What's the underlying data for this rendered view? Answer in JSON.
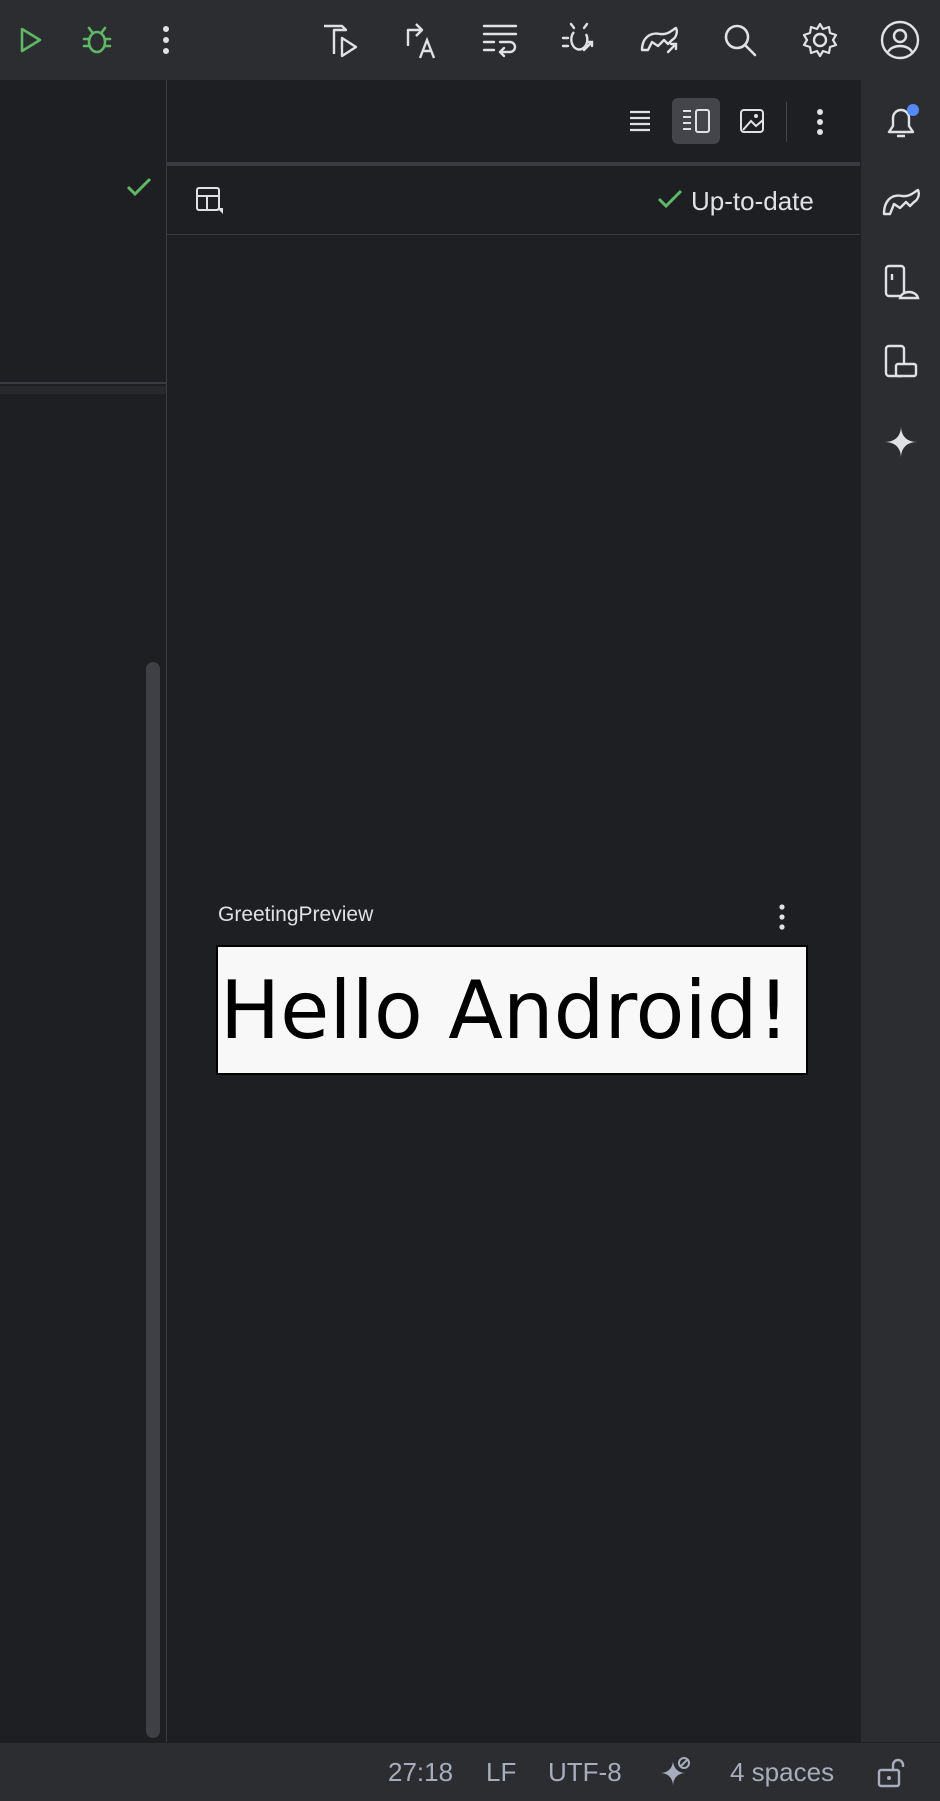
{
  "toolbar": {
    "icons": [
      "run-icon",
      "debug-icon",
      "more-vertical-icon",
      "build-run-icon",
      "translate-icon",
      "sync-icon",
      "bug-sync-icon",
      "gradle-sync-icon",
      "search-icon",
      "settings-icon",
      "account-icon"
    ]
  },
  "preview": {
    "status_label": "Up-to-date",
    "composable_name": "GreetingPreview",
    "rendered_text": "Hello Android!"
  },
  "status_bar": {
    "cursor_position": "27:18",
    "line_separator": "LF",
    "encoding": "UTF-8",
    "indent": "4 spaces"
  },
  "colors": {
    "accent_green": "#5fb865",
    "notification_dot": "#548af7",
    "panel_bg": "#1e1f22",
    "toolbar_bg": "#2b2d30"
  }
}
